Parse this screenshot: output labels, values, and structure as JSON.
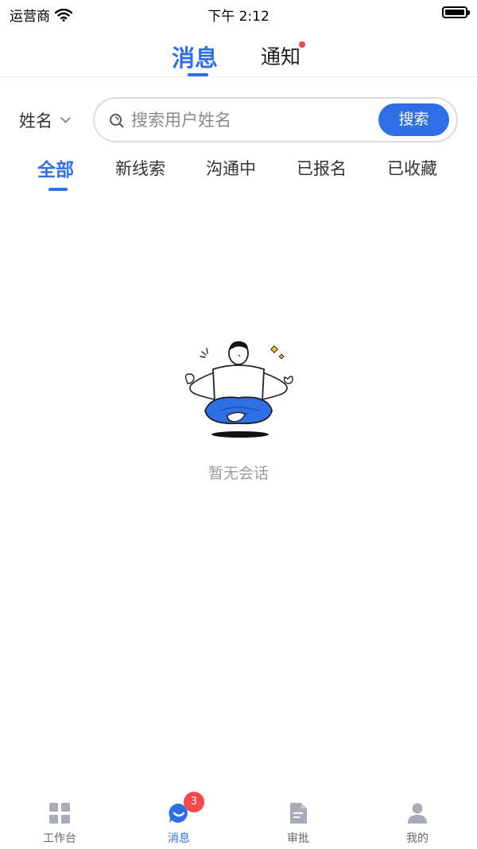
{
  "status_bar": {
    "carrier": "运营商",
    "time": "下午 2:12"
  },
  "top_tabs": [
    {
      "label": "消息",
      "active": true
    },
    {
      "label": "通知",
      "active": false,
      "has_dot": true
    }
  ],
  "search": {
    "filter_label": "姓名",
    "placeholder": "搜索用户姓名",
    "value": "",
    "button_label": "搜索"
  },
  "sub_tabs": [
    {
      "label": "全部",
      "active": true
    },
    {
      "label": "新线索",
      "active": false
    },
    {
      "label": "沟通中",
      "active": false
    },
    {
      "label": "已报名",
      "active": false
    },
    {
      "label": "已收藏",
      "active": false
    }
  ],
  "empty_state": {
    "text": "暂无会话",
    "icon": "meditating-person-illustration"
  },
  "bottom_nav": [
    {
      "label": "工作台",
      "icon": "grid-icon",
      "active": false
    },
    {
      "label": "消息",
      "icon": "chat-icon",
      "active": true,
      "badge": "3"
    },
    {
      "label": "审批",
      "icon": "document-icon",
      "active": false
    },
    {
      "label": "我的",
      "icon": "person-icon",
      "active": false
    }
  ],
  "colors": {
    "accent": "#2f6fe6",
    "badge": "#f5474e",
    "muted": "#9a9a9a",
    "icon_inactive": "#a7acb8"
  }
}
